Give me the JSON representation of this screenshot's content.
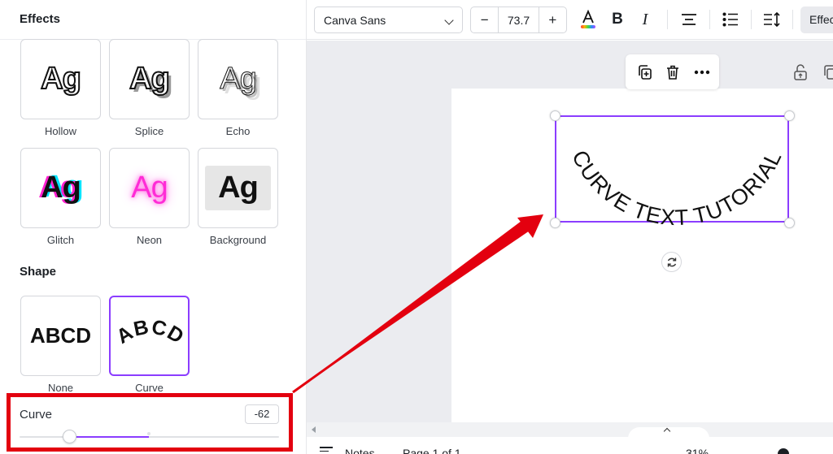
{
  "panel": {
    "title": "Effects",
    "effects": [
      {
        "label": "Hollow",
        "preview": "Ag",
        "icon": "hollow-effect-preview"
      },
      {
        "label": "Splice",
        "preview": "Ag",
        "icon": "splice-effect-preview"
      },
      {
        "label": "Echo",
        "preview": "Ag",
        "icon": "echo-effect-preview"
      },
      {
        "label": "Glitch",
        "preview": "Ag",
        "icon": "glitch-effect-preview"
      },
      {
        "label": "Neon",
        "preview": "Ag",
        "icon": "neon-effect-preview"
      },
      {
        "label": "Background",
        "preview": "Ag",
        "icon": "background-effect-preview"
      }
    ],
    "shape_title": "Shape",
    "shapes": [
      {
        "label": "None",
        "preview": "ABCD",
        "selected": false
      },
      {
        "label": "Curve",
        "preview": "ABCD",
        "selected": true
      }
    ],
    "curve": {
      "label": "Curve",
      "value": "-62",
      "numeric_value": -62,
      "min": -100,
      "max": 100
    }
  },
  "toolbar": {
    "font_family": "Canva Sans",
    "font_size": "73.7",
    "decrease_label": "−",
    "increase_label": "+",
    "effects_label": "Effects",
    "icons": [
      "text-color-icon",
      "bold-icon",
      "italic-icon",
      "align-center-icon",
      "list-icon",
      "spacing-icon"
    ]
  },
  "canvas": {
    "curved_text": "CURVE TEXT TUTORIAL",
    "floating_toolbar_icons": [
      "duplicate-icon",
      "delete-icon",
      "more-icon"
    ],
    "page_icons": [
      "unlock-icon",
      "duplicate-page-icon"
    ]
  },
  "statusbar": {
    "notes_label": "Notes",
    "page_label": "Page 1 of 1",
    "zoom_label": "31%"
  },
  "colors": {
    "accent": "#8b3dff",
    "annotation": "#e3000f",
    "neon": "#ff2bd6",
    "glitch_cyan": "#00e5ff"
  }
}
